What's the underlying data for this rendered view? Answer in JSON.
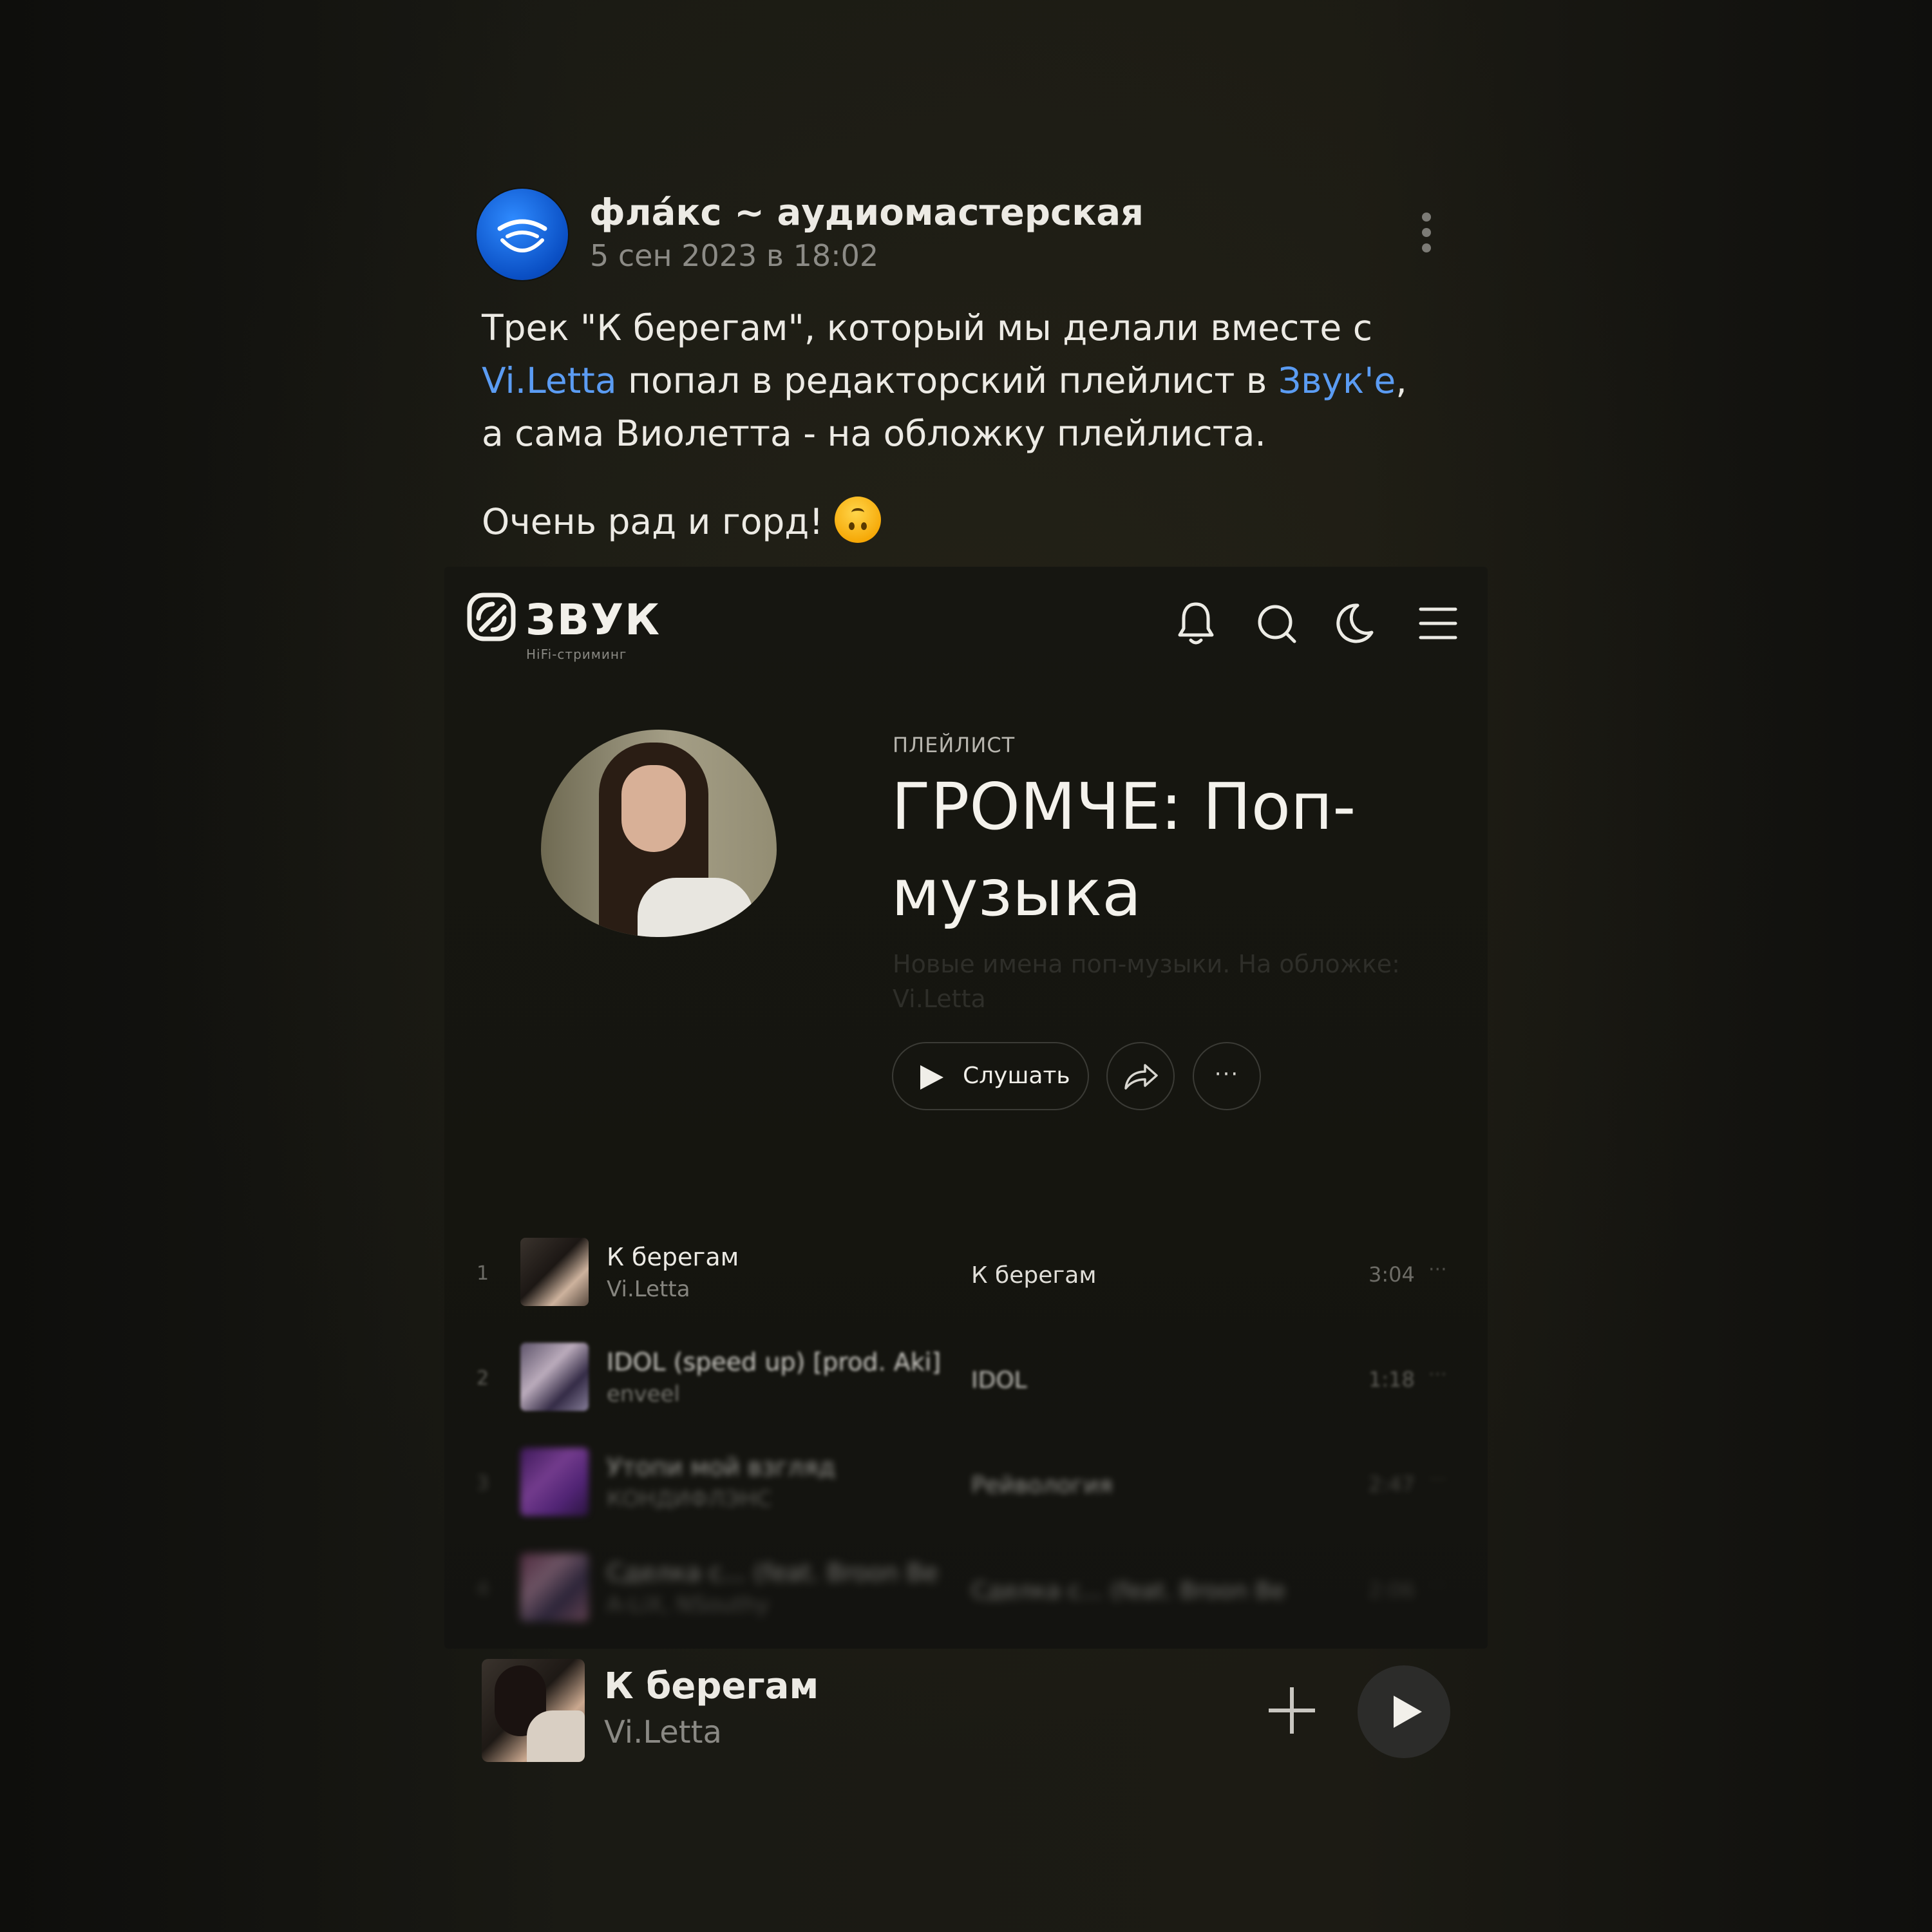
{
  "post": {
    "author": "фла́кс ~ аудиомастерская",
    "date": "5 сен 2023 в 18:02",
    "text_before_link1": "Трек \"К берегам\", который мы делали вместе с ",
    "link1": "Vi.Letta",
    "text_between_links": " попал в редакторский плейлист в ",
    "link2": "Звук'е",
    "text_after_link2": ", а сама Виолетта - на обложку плейлиста.",
    "second_paragraph": "Очень рад и горд!",
    "emoji": "upside-down-face-emoji"
  },
  "app": {
    "logo_text": "ЗВУК",
    "logo_subtitle": "HiFi-стриминг",
    "icons": [
      "bell-icon",
      "search-icon",
      "moon-icon",
      "menu-icon"
    ]
  },
  "playlist": {
    "kind": "ПЛЕЙЛИСТ",
    "title": "ГРОМЧЕ: Поп-музыка",
    "description": "Новые имена поп-музыки. На обложке: Vi.Letta",
    "listen_label": "Слушать",
    "more_label": "···"
  },
  "tracks": [
    {
      "num": "1",
      "title": "К берегам",
      "artist": "Vi.Letta",
      "album": "К берегам",
      "duration": "3:04",
      "more": "···"
    },
    {
      "num": "2",
      "title": "IDOL (speed up) [prod. Aki]",
      "artist": "enveel",
      "album": "IDOL",
      "duration": "1:18",
      "more": "···"
    },
    {
      "num": "3",
      "title": "Утопи мой взгляд",
      "artist": "КОНДИФЛЭНС",
      "album": "Рейвология",
      "duration": "2:47",
      "more": "···"
    },
    {
      "num": "4",
      "title": "Сделка с... (feat. Broon Be",
      "artist": "A-LiX, NSouthy",
      "album": "Сделка с... (feat. Broon Be",
      "duration": "2:06",
      "more": "···"
    }
  ],
  "player": {
    "title": "К берегам",
    "artist": "Vi.Letta"
  },
  "colors": {
    "link": "#5b9cf3",
    "background": "#141410",
    "text": "#eceae4"
  }
}
